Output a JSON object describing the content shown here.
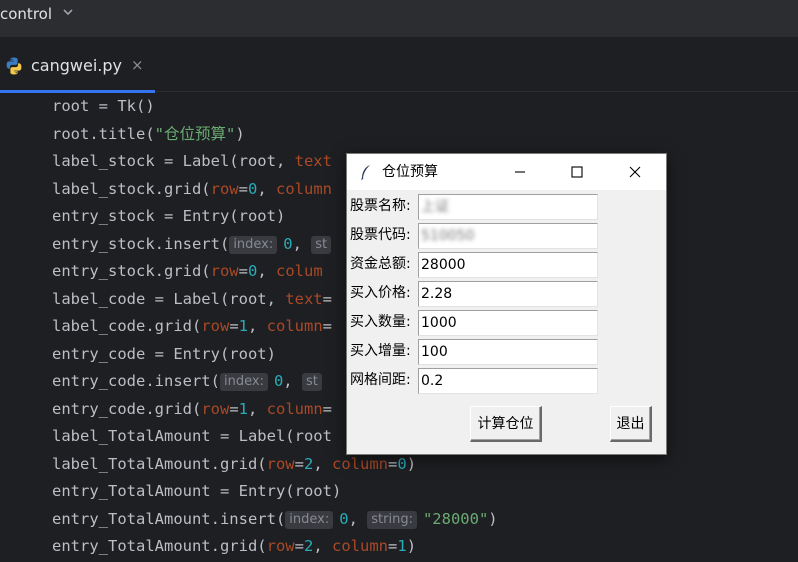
{
  "ide": {
    "project_name": "control",
    "tab": {
      "filename": "cangwei.py",
      "close_glyph": "×",
      "icon": "python-icon"
    },
    "accent": "#3574f0"
  },
  "code_lines": [
    [
      {
        "t": "root = Tk()"
      }
    ],
    [
      {
        "t": "root.title("
      },
      {
        "t": "\"仓位预算\"",
        "c": "s"
      },
      {
        "t": ")"
      }
    ],
    [
      {
        "t": "label_stock = Label(root, "
      },
      {
        "t": "text",
        "c": "kw"
      }
    ],
    [
      {
        "t": "label_stock.grid("
      },
      {
        "t": "row",
        "c": "kw"
      },
      {
        "t": "="
      },
      {
        "t": "0",
        "c": "n"
      },
      {
        "t": ", "
      },
      {
        "t": "column",
        "c": "kw"
      }
    ],
    [
      {
        "t": "entry_stock = Entry(root)"
      }
    ],
    [
      {
        "t": "entry_stock.insert("
      },
      {
        "h": "index:"
      },
      {
        "t": "0",
        "c": "n"
      },
      {
        "t": ", "
      },
      {
        "h": "st"
      }
    ],
    [
      {
        "t": "entry_stock.grid("
      },
      {
        "t": "row",
        "c": "kw"
      },
      {
        "t": "="
      },
      {
        "t": "0",
        "c": "n"
      },
      {
        "t": ", "
      },
      {
        "t": "colum",
        "c": "kw"
      }
    ],
    [
      {
        "t": "label_code = Label(root, "
      },
      {
        "t": "text",
        "c": "kw"
      },
      {
        "t": "="
      }
    ],
    [
      {
        "t": "label_code.grid("
      },
      {
        "t": "row",
        "c": "kw"
      },
      {
        "t": "="
      },
      {
        "t": "1",
        "c": "n"
      },
      {
        "t": ", "
      },
      {
        "t": "column",
        "c": "kw"
      },
      {
        "t": "="
      }
    ],
    [
      {
        "t": "entry_code = Entry(root)"
      }
    ],
    [
      {
        "t": "entry_code.insert("
      },
      {
        "h": "index:"
      },
      {
        "t": "0",
        "c": "n"
      },
      {
        "t": ", "
      },
      {
        "h": "st"
      }
    ],
    [
      {
        "t": "entry_code.grid("
      },
      {
        "t": "row",
        "c": "kw"
      },
      {
        "t": "="
      },
      {
        "t": "1",
        "c": "n"
      },
      {
        "t": ", "
      },
      {
        "t": "column",
        "c": "kw"
      },
      {
        "t": "="
      }
    ],
    [
      {
        "t": "label_TotalAmount = Label(root"
      }
    ],
    [
      {
        "t": "label_TotalAmount.grid("
      },
      {
        "t": "row",
        "c": "kw"
      },
      {
        "t": "="
      },
      {
        "t": "2",
        "c": "n"
      },
      {
        "t": ", "
      },
      {
        "t": "column",
        "c": "kw"
      },
      {
        "t": "="
      },
      {
        "t": "0",
        "c": "n"
      },
      {
        "t": ")"
      }
    ],
    [
      {
        "t": "entry_TotalAmount = Entry(root)"
      }
    ],
    [
      {
        "t": "entry_TotalAmount.insert("
      },
      {
        "h": "index:"
      },
      {
        "t": "0",
        "c": "n"
      },
      {
        "t": ", "
      },
      {
        "h": "string:"
      },
      {
        "t": "\"28000\"",
        "c": "s"
      },
      {
        "t": ")"
      }
    ],
    [
      {
        "t": "entry_TotalAmount.grid("
      },
      {
        "t": "row",
        "c": "kw"
      },
      {
        "t": "="
      },
      {
        "t": "2",
        "c": "n"
      },
      {
        "t": ", "
      },
      {
        "t": "column",
        "c": "kw"
      },
      {
        "t": "="
      },
      {
        "t": "1",
        "c": "n"
      },
      {
        "t": ")"
      }
    ]
  ],
  "tk_window": {
    "title": "仓位预算",
    "fields": [
      {
        "label": "股票名称:",
        "value": "上证",
        "obscured": true
      },
      {
        "label": "股票代码:",
        "value": "510050",
        "obscured": true
      },
      {
        "label": "资金总额:",
        "value": "28000",
        "obscured": false
      },
      {
        "label": "买入价格:",
        "value": "2.28",
        "obscured": false
      },
      {
        "label": "买入数量:",
        "value": "1000",
        "obscured": false
      },
      {
        "label": "买入增量:",
        "value": "100",
        "obscured": false
      },
      {
        "label": "网格间距:",
        "value": "0.2",
        "obscured": false
      }
    ],
    "calc_button": "计算仓位",
    "exit_button": "退出"
  }
}
